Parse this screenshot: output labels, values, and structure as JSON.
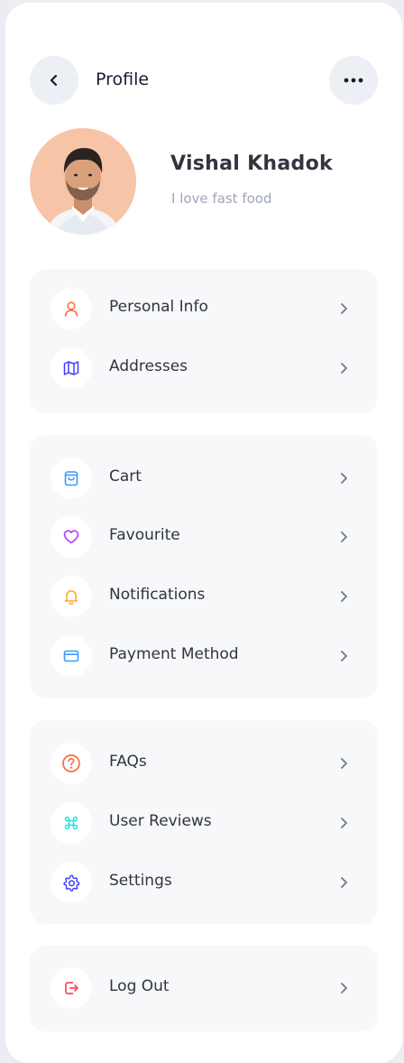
{
  "header": {
    "title": "Profile",
    "back_icon": "chevron-left-icon",
    "more_icon": "more-horizontal-icon"
  },
  "profile": {
    "name": "Vishal Khadok",
    "bio": "I love fast food"
  },
  "groups": [
    {
      "items": [
        {
          "label": "Personal Info",
          "icon": "user-icon",
          "color": "#fb6f3d"
        },
        {
          "label": "Addresses",
          "icon": "map-icon",
          "color": "#413dfb"
        }
      ]
    },
    {
      "items": [
        {
          "label": "Cart",
          "icon": "shopping-bag-icon",
          "color": "#369bff"
        },
        {
          "label": "Favourite",
          "icon": "heart-icon",
          "color": "#b33dfb"
        },
        {
          "label": "Notifications",
          "icon": "bell-icon",
          "color": "#ffaa2a"
        },
        {
          "label": "Payment Method",
          "icon": "credit-card-icon",
          "color": "#369bff"
        }
      ]
    },
    {
      "items": [
        {
          "label": "FAQs",
          "icon": "help-circle-icon",
          "color": "#fb6d3a"
        },
        {
          "label": "User Reviews",
          "icon": "command-icon",
          "color": "#2ae1e1"
        },
        {
          "label": "Settings",
          "icon": "settings-icon",
          "color": "#413dfb"
        }
      ]
    },
    {
      "items": [
        {
          "label": "Log Out",
          "icon": "logout-icon",
          "color": "#fb4a59"
        }
      ]
    }
  ]
}
